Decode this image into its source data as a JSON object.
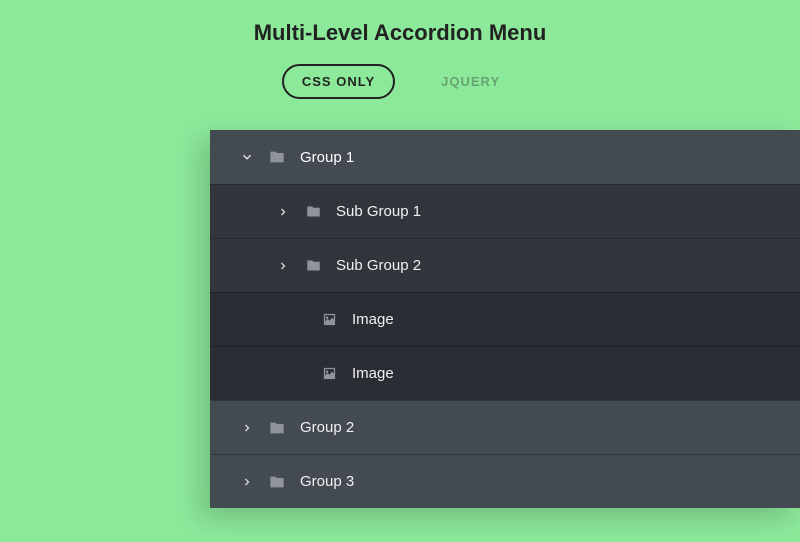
{
  "page_title": "Multi-Level Accordion Menu",
  "tabs": [
    {
      "label": "CSS ONLY"
    },
    {
      "label": "JQUERY"
    }
  ],
  "menu": {
    "rows": [
      {
        "label": "Group 1"
      },
      {
        "label": "Sub Group 1"
      },
      {
        "label": "Sub Group 2"
      },
      {
        "label": "Image"
      },
      {
        "label": "Image"
      },
      {
        "label": "Group 2"
      },
      {
        "label": "Group 3"
      }
    ]
  }
}
